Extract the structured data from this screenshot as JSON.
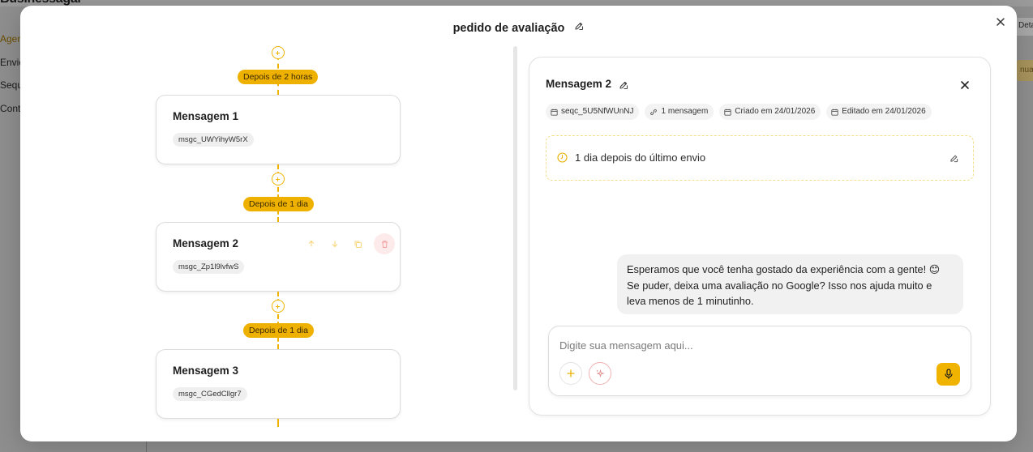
{
  "background": {
    "brand": "Businessagai",
    "nav_items": [
      "Agen",
      "Envio",
      "Seque",
      "Conta"
    ],
    "right_pill": "Deta",
    "right_button": "nua"
  },
  "modal": {
    "title": "pedido de avaliação",
    "flow": {
      "steps": [
        {
          "delay": "Depois de 2 horas",
          "name": "Mensagem 1",
          "code": "msgc_UWYihyW5rX"
        },
        {
          "delay": "Depois de 1 dia",
          "name": "Mensagem 2",
          "code": "msgc_Zp1l9lvfwS"
        },
        {
          "delay": "Depois de 1 dia",
          "name": "Mensagem 3",
          "code": "msgc_CGedCllgr7"
        }
      ]
    },
    "detail": {
      "title": "Mensagem 2",
      "tags": {
        "sequence_id": "seqc_5U5NfWUnNJ",
        "message_count": "1 mensagem",
        "created": "Criado em 24/01/2026",
        "edited": "Editado em 24/01/2026"
      },
      "delay_text": "1 dia depois do último envio",
      "message_bubble": "Esperamos que você tenha gostado da experiência com a gente! 😊 Se puder, deixa uma avaliação no Google? Isso nos ajuda muito e leva menos de 1 minutinho.",
      "composer": {
        "placeholder": "Digite sua mensagem aqui..."
      }
    }
  },
  "colors": {
    "accent": "#f0b400",
    "pill": "#efb100",
    "danger_bg": "#fdeaea"
  }
}
